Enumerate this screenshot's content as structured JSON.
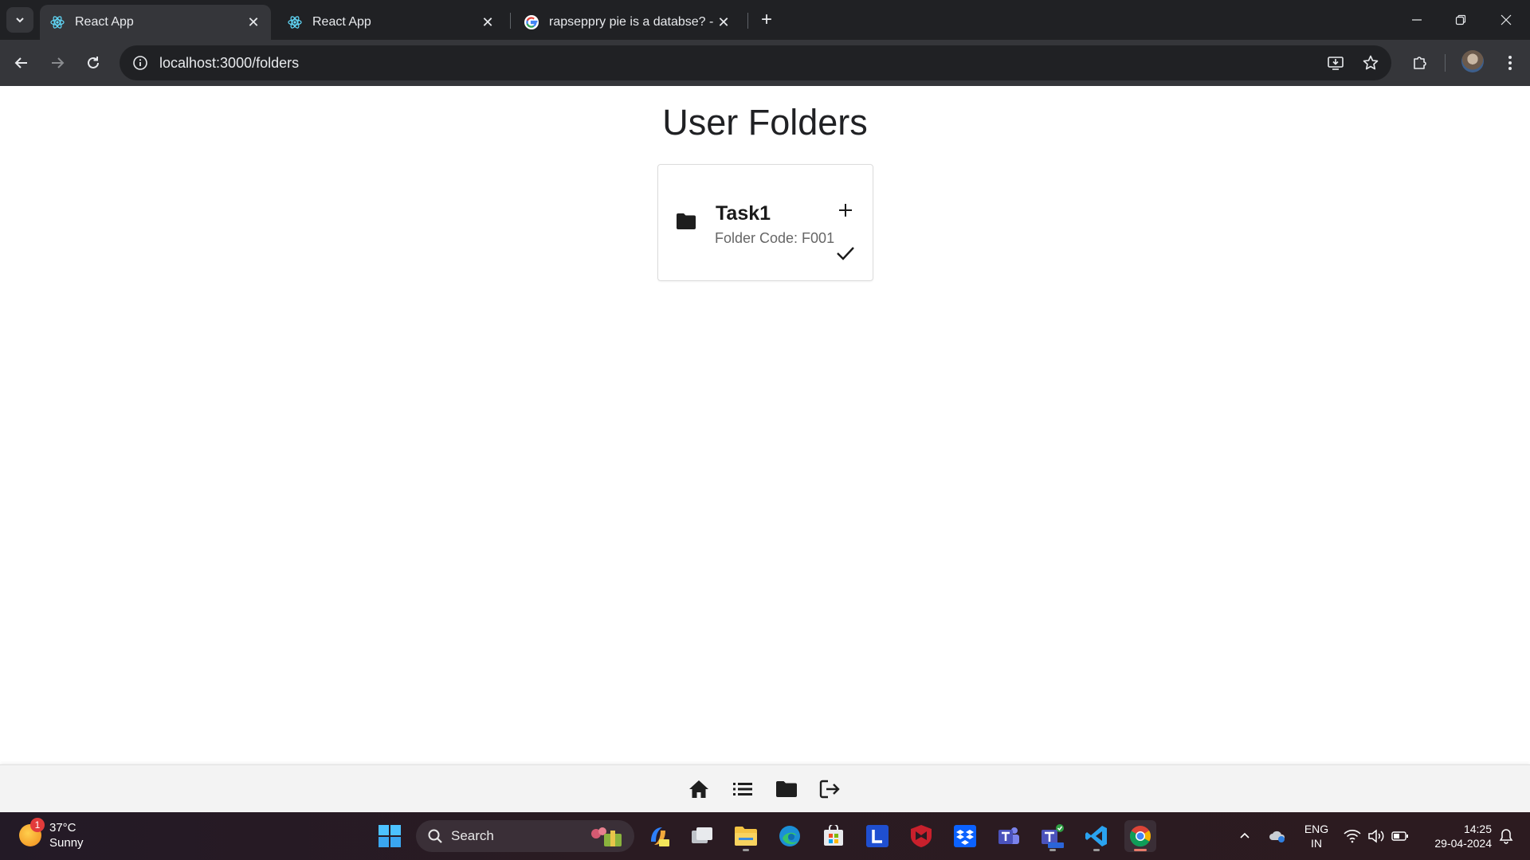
{
  "browser": {
    "tabs": [
      {
        "title": "React App",
        "active": true
      },
      {
        "title": "React App",
        "active": false
      },
      {
        "title": "rapsepprу pie is a databse? - Go",
        "active": false
      }
    ],
    "url": "localhost:3000/folders"
  },
  "page": {
    "title": "User Folders",
    "folders": [
      {
        "name": "Task1",
        "code_label": "Folder Code: F001"
      }
    ]
  },
  "taskbar": {
    "weather": {
      "temp": "37°C",
      "condition": "Sunny",
      "badge": "1"
    },
    "search_label": "Search",
    "lang_line1": "ENG",
    "lang_line2": "IN",
    "time": "14:25",
    "date": "29-04-2024"
  },
  "colors": {
    "tabstrip": "#202124",
    "toolbar": "#35363a",
    "bottom_nav": "#f3f3f3"
  }
}
